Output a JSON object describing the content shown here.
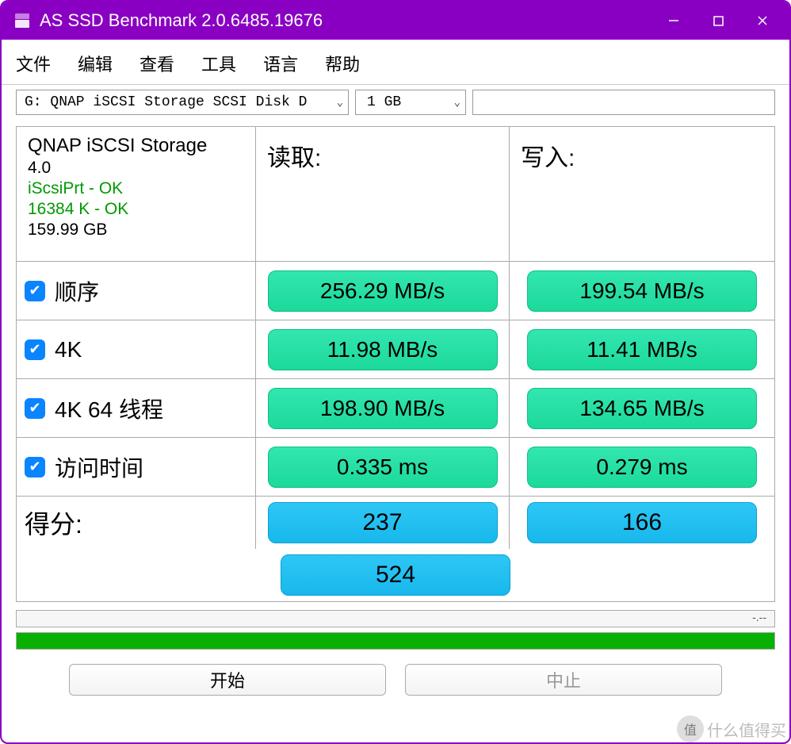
{
  "window": {
    "title": "AS SSD Benchmark 2.0.6485.19676"
  },
  "menu": {
    "file": "文件",
    "edit": "编辑",
    "view": "查看",
    "tools": "工具",
    "language": "语言",
    "help": "帮助"
  },
  "toolbar": {
    "disk": "G: QNAP iSCSI Storage SCSI Disk D",
    "size": "1 GB"
  },
  "device": {
    "name": "QNAP iSCSI Storage",
    "version": "4.0",
    "driver_ok": "iScsiPrt - OK",
    "align_ok": "16384 K - OK",
    "capacity": "159.99 GB"
  },
  "headers": {
    "read": "读取:",
    "write": "写入:"
  },
  "tests": {
    "seq": {
      "label": "顺序",
      "read": "256.29 MB/s",
      "write": "199.54 MB/s"
    },
    "k4": {
      "label": "4K",
      "read": "11.98 MB/s",
      "write": "11.41 MB/s"
    },
    "k4t64": {
      "label": "4K 64 线程",
      "read": "198.90 MB/s",
      "write": "134.65 MB/s"
    },
    "access": {
      "label": "访问时间",
      "read": "0.335 ms",
      "write": "0.279 ms"
    }
  },
  "score": {
    "label": "得分:",
    "read": "237",
    "write": "166",
    "total": "524"
  },
  "progress": {
    "placeholder": "-.--"
  },
  "buttons": {
    "start": "开始",
    "stop": "中止"
  },
  "watermark": {
    "badge": "值",
    "text": "什么值得买"
  }
}
